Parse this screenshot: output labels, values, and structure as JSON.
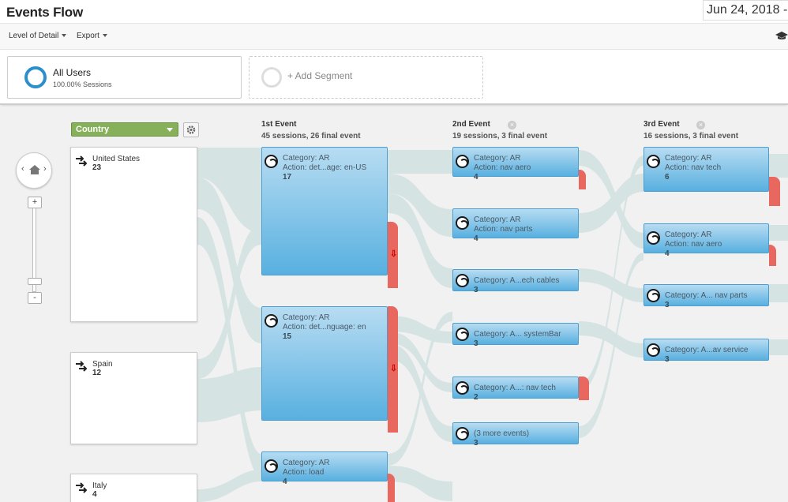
{
  "header": {
    "title": "Events Flow",
    "date": "Jun 24, 2018 -"
  },
  "toolbar": {
    "level_of_detail": "Level of Detail",
    "export": "Export"
  },
  "segments": {
    "all_users": "All Users",
    "all_users_sub": "100.00% Sessions",
    "add_segment": "+ Add Segment"
  },
  "dimension": {
    "selected": "Country"
  },
  "countries": [
    {
      "label": "United States",
      "value": "23"
    },
    {
      "label": "Spain",
      "value": "12"
    },
    {
      "label": "Italy",
      "value": "4"
    }
  ],
  "steps": [
    {
      "title": "1st Event",
      "subtitle": "45 sessions, 26 final event"
    },
    {
      "title": "2nd Event",
      "subtitle": "19 sessions, 3 final event"
    },
    {
      "title": "3rd Event",
      "subtitle": "16 sessions, 3 final event"
    }
  ],
  "events": {
    "e1": [
      {
        "category": "Category: AR",
        "action": "Action: det...age: en-US",
        "value": "17"
      },
      {
        "category": "Category: AR",
        "action": "Action: det...nguage: en",
        "value": "15"
      },
      {
        "category": "Category: AR",
        "action": "Action: load",
        "value": "4"
      }
    ],
    "e2": [
      {
        "category": "Category: AR",
        "action": "Action: nav aero",
        "value": "4"
      },
      {
        "category": "Category: AR",
        "action": "Action: nav parts",
        "value": "4"
      },
      {
        "category": "Category: A...ech cables",
        "value": "3"
      },
      {
        "category": "Category: A... systemBar",
        "value": "3"
      },
      {
        "category": "Category: A...: nav tech",
        "value": "2"
      },
      {
        "category": "(3 more events)",
        "value": "3"
      }
    ],
    "e3": [
      {
        "category": "Category: AR",
        "action": "Action: nav tech",
        "value": "6"
      },
      {
        "category": "Category: AR",
        "action": "Action: nav aero",
        "value": "4"
      },
      {
        "category": "Category: A... nav parts",
        "value": "3"
      },
      {
        "category": "Category: A...av service",
        "value": "3"
      }
    ]
  },
  "zoom": {
    "plus": "+",
    "minus": "-"
  }
}
